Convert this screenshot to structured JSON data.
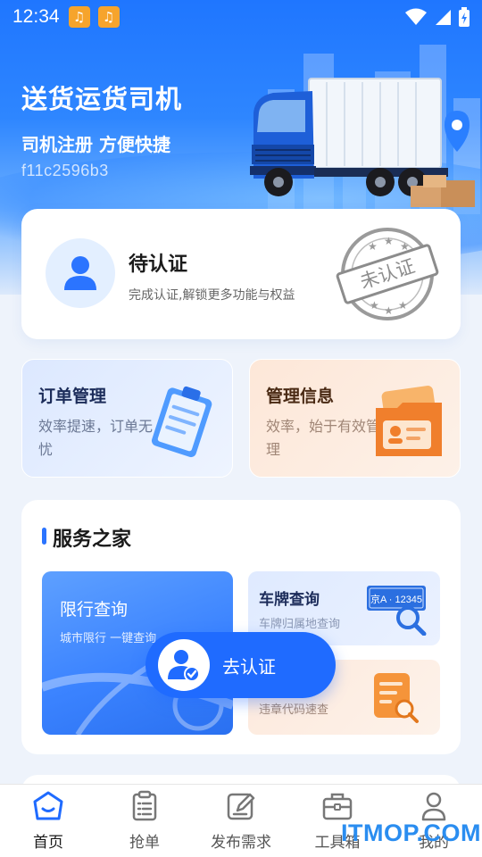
{
  "status_bar": {
    "time": "12:34"
  },
  "hero": {
    "title": "送货运货司机",
    "subtitle": "司机注册 方便快捷",
    "code": "f11c2596b3"
  },
  "verify_card": {
    "title": "待认证",
    "description": "完成认证,解锁更多功能与权益",
    "stamp_text": "未认证"
  },
  "features": [
    {
      "title": "订单管理",
      "description": "效率提速，订单无忧"
    },
    {
      "title": "管理信息",
      "description": "效率，始于有效管理"
    }
  ],
  "services": {
    "title": "服务之家",
    "items": [
      {
        "title": "限行查询",
        "description": "城市限行 一键查询"
      },
      {
        "title": "车牌查询",
        "description": "车牌归属地查询",
        "plate_text": "京A · 12345"
      },
      {
        "description": "违章代码速查"
      }
    ]
  },
  "float_button": {
    "label": "去认证"
  },
  "tabbar": {
    "items": [
      {
        "label": "首页",
        "icon": "home-icon",
        "active": true
      },
      {
        "label": "抢单",
        "icon": "clipboard-icon"
      },
      {
        "label": "发布需求",
        "icon": "edit-icon"
      },
      {
        "label": "工具箱",
        "icon": "toolbox-icon"
      },
      {
        "label": "我的",
        "icon": "user-icon"
      }
    ]
  },
  "watermark": "ITMOP.COM",
  "colors": {
    "primary": "#1f6bff",
    "hero_top": "#1f76ff",
    "order_bg": "#dce8ff",
    "mgmt_bg": "#fde7d8",
    "orange": "#f6a42c"
  }
}
